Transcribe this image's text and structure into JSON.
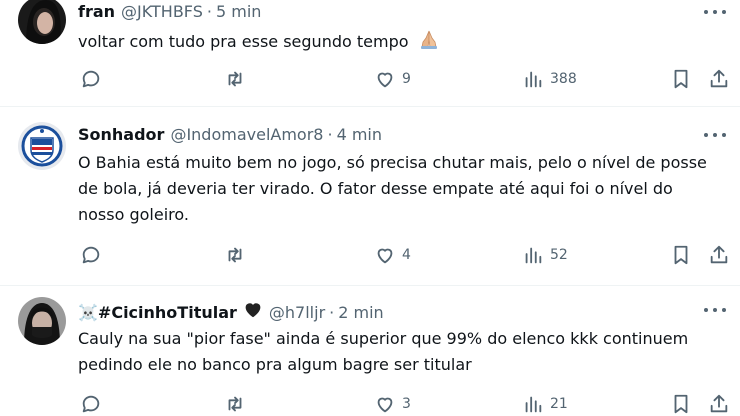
{
  "tweets": [
    {
      "name": "fran",
      "handle": "@JKTHBFS",
      "time": "5 min",
      "text": "voltar com tudo pra esse segundo tempo",
      "emoji": "folded-hands-icon",
      "likes": "9",
      "views": "388"
    },
    {
      "name": "Sonhador",
      "handle": "@IndomavelAmor8",
      "time": "4 min",
      "text_lines": [
        "O Bahia está muito bem no jogo, só precisa chutar mais, pelo o nível de posse",
        "de bola, já deveria ter virado. O fator desse empate até aqui foi o nível do",
        "nosso goleiro."
      ],
      "likes": "4",
      "views": "52"
    },
    {
      "name": "☠️#CicinhoTitular",
      "handle": "@h7lljr",
      "time": "2 min",
      "text_lines": [
        "Cauly na sua \"pior fase\" ainda é superior que 99% do elenco kkk continuem",
        "pedindo ele no banco pra algum bagre ser titular"
      ],
      "likes": "3",
      "views": "21"
    }
  ],
  "separator": "·",
  "colors": {
    "text": "#0f1419",
    "secondary": "#536471",
    "divider": "#eff3f4",
    "bahia_blue": "#1b4f9c",
    "bahia_red": "#d62027"
  }
}
